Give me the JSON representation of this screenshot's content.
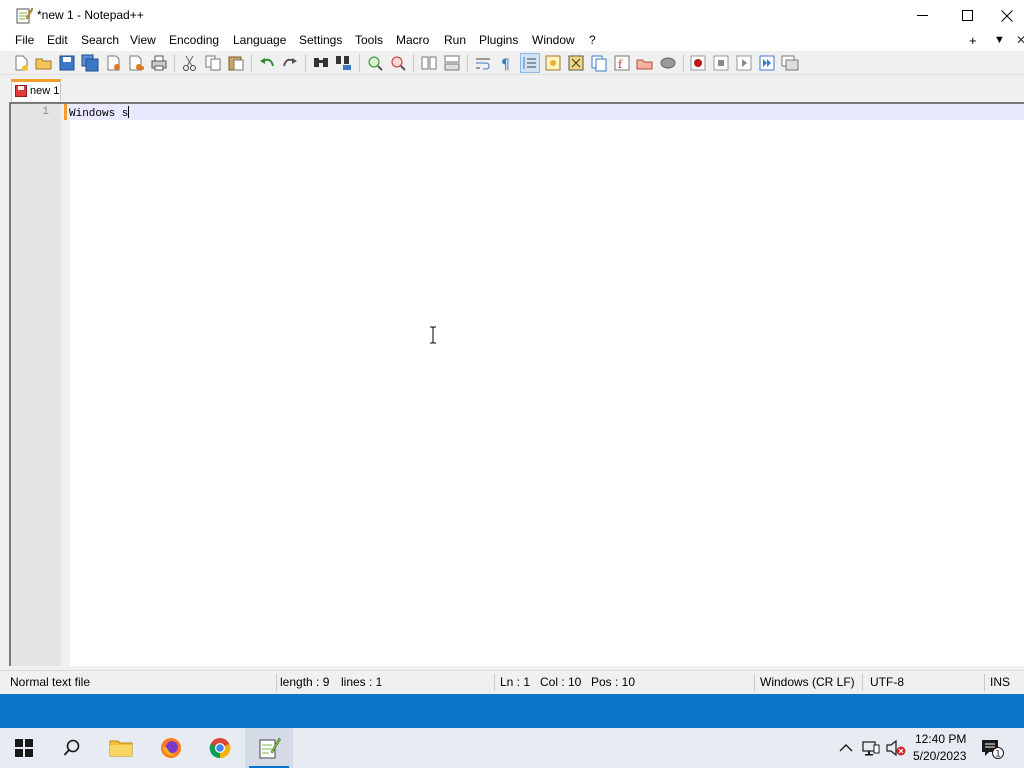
{
  "window": {
    "title": "*new 1 - Notepad++"
  },
  "menu": {
    "items": [
      "File",
      "Edit",
      "Search",
      "View",
      "Encoding",
      "Language",
      "Settings",
      "Tools",
      "Macro",
      "Run",
      "Plugins",
      "Window",
      "?"
    ],
    "right": {
      "plus": "+",
      "down": "▼",
      "close": "✕"
    }
  },
  "tabs": [
    {
      "label": "new 1",
      "modified": true
    }
  ],
  "editor": {
    "lines": [
      {
        "number": "1",
        "text": "Windows s"
      }
    ]
  },
  "status": {
    "file_type": "Normal text file",
    "length": "length : 9",
    "lines": "lines : 1",
    "ln": "Ln : 1",
    "col": "Col : 10",
    "pos": "Pos : 10",
    "eol": "Windows (CR LF)",
    "encoding": "UTF-8",
    "mode": "INS"
  },
  "taskbar": {
    "apps": [
      "start-icon",
      "search-icon",
      "file-explorer-icon",
      "firefox-icon",
      "chrome-icon",
      "notepadpp-icon"
    ],
    "clock_time": "12:40 PM",
    "clock_date": "5/20/2023",
    "notification_count": "1"
  },
  "colors": {
    "accent_tab": "#f59c2e",
    "current_line": "#e8e8ff",
    "desktop": "#0a74c9"
  }
}
